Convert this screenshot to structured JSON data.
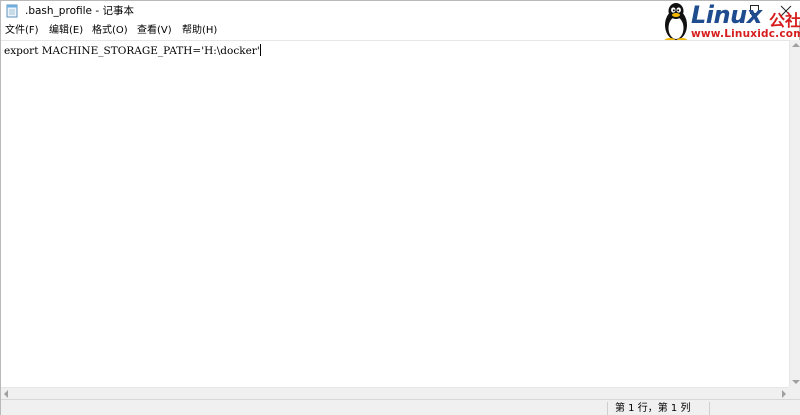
{
  "window": {
    "title": ".bash_profile - 记事本",
    "icons": {
      "app": "notepad-icon",
      "maximize": "maximize-icon",
      "close": "close-icon"
    }
  },
  "watermark": {
    "main": "Linux",
    "cn": "公社",
    "url": "www.Linuxidc.com",
    "icon": "tux-penguin-icon",
    "colors": {
      "blue": "#1f4b8f",
      "red": "#d71e1e"
    }
  },
  "menu": {
    "items": [
      {
        "label": "文件(F)"
      },
      {
        "label": "编辑(E)"
      },
      {
        "label": "格式(O)"
      },
      {
        "label": "查看(V)"
      },
      {
        "label": "帮助(H)"
      }
    ]
  },
  "editor": {
    "content": "export MACHINE_STORAGE_PATH='H:\\docker'"
  },
  "status": {
    "position": "第 1 行，第 1 列"
  }
}
